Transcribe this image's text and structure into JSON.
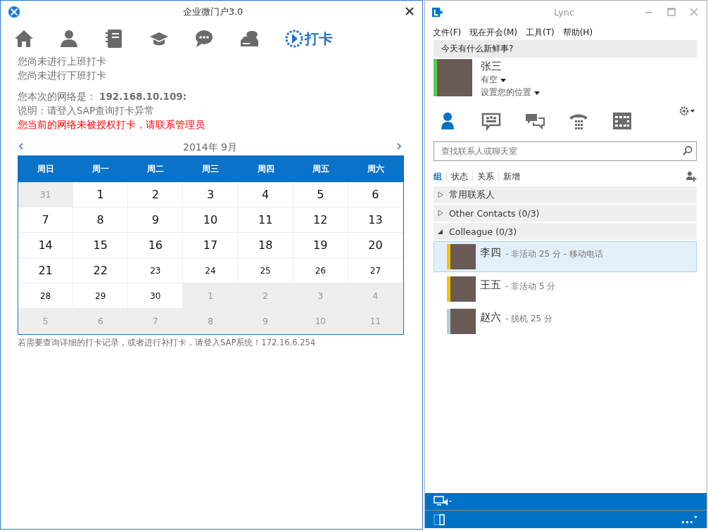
{
  "portal": {
    "title": "企业微门户3.0",
    "nav": [
      {
        "selected": false
      },
      {
        "selected": false
      },
      {
        "selected": false
      },
      {
        "selected": false
      },
      {
        "selected": false
      },
      {
        "selected": false
      },
      {
        "label": "打卡",
        "selected": true
      }
    ],
    "status_lines": [
      "您尚未进行上班打卡",
      "您尚未进行下班打卡"
    ],
    "network_label": "您本次的网络是：",
    "network_ip": "192.168.10.109:",
    "note": "说明：请登入SAP查询打卡异常",
    "warning": "您当前的网络未被授权打卡，请联系管理员",
    "calendar": {
      "month": "2014年 9月",
      "weekdays": [
        "周日",
        "周一",
        "周二",
        "周三",
        "周四",
        "周五",
        "周六"
      ],
      "weeks": [
        [
          {
            "day": "31",
            "in_month": false,
            "large": false
          },
          {
            "day": "1",
            "in_month": true,
            "large": true
          },
          {
            "day": "2",
            "in_month": true,
            "large": true
          },
          {
            "day": "3",
            "in_month": true,
            "large": true
          },
          {
            "day": "4",
            "in_month": true,
            "large": true
          },
          {
            "day": "5",
            "in_month": true,
            "large": true
          },
          {
            "day": "6",
            "in_month": true,
            "large": true
          }
        ],
        [
          {
            "day": "7",
            "in_month": true,
            "large": true
          },
          {
            "day": "8",
            "in_month": true,
            "large": true
          },
          {
            "day": "9",
            "in_month": true,
            "large": true
          },
          {
            "day": "10",
            "in_month": true,
            "large": true
          },
          {
            "day": "11",
            "in_month": true,
            "large": true
          },
          {
            "day": "12",
            "in_month": true,
            "large": true
          },
          {
            "day": "13",
            "in_month": true,
            "large": true
          }
        ],
        [
          {
            "day": "14",
            "in_month": true,
            "large": true
          },
          {
            "day": "15",
            "in_month": true,
            "large": true
          },
          {
            "day": "16",
            "in_month": true,
            "large": true
          },
          {
            "day": "17",
            "in_month": true,
            "large": true
          },
          {
            "day": "18",
            "in_month": true,
            "large": true
          },
          {
            "day": "19",
            "in_month": true,
            "large": true
          },
          {
            "day": "20",
            "in_month": true,
            "large": true
          }
        ],
        [
          {
            "day": "21",
            "in_month": true,
            "large": true
          },
          {
            "day": "22",
            "in_month": true,
            "large": true
          },
          {
            "day": "23",
            "in_month": true,
            "large": false
          },
          {
            "day": "24",
            "in_month": true,
            "large": false
          },
          {
            "day": "25",
            "in_month": true,
            "large": false
          },
          {
            "day": "26",
            "in_month": true,
            "large": false
          },
          {
            "day": "27",
            "in_month": true,
            "large": false
          }
        ],
        [
          {
            "day": "28",
            "in_month": true,
            "large": false
          },
          {
            "day": "29",
            "in_month": true,
            "large": false
          },
          {
            "day": "30",
            "in_month": true,
            "large": false
          },
          {
            "day": "1",
            "in_month": false,
            "large": false
          },
          {
            "day": "2",
            "in_month": false,
            "large": false
          },
          {
            "day": "3",
            "in_month": false,
            "large": false
          },
          {
            "day": "4",
            "in_month": false,
            "large": false
          }
        ],
        [
          {
            "day": "5",
            "in_month": false,
            "large": false
          },
          {
            "day": "6",
            "in_month": false,
            "large": false
          },
          {
            "day": "7",
            "in_month": false,
            "large": false
          },
          {
            "day": "8",
            "in_month": false,
            "large": false
          },
          {
            "day": "9",
            "in_month": false,
            "large": false
          },
          {
            "day": "10",
            "in_month": false,
            "large": false
          },
          {
            "day": "11",
            "in_month": false,
            "large": false
          }
        ]
      ]
    },
    "footer": "若需要查询详细的打卡记录，或者进行补打卡，请登入SAP系统！172.16.6.254"
  },
  "lync": {
    "title": "Lync",
    "menu": [
      "文件(F)",
      "现在开会(M)",
      "工具(T)",
      "帮助(H)"
    ],
    "whats_new": "今天有什么新鲜事?",
    "me": {
      "name": "张三",
      "status": "有空",
      "location": "设置您的位置",
      "color": "#5cc94a"
    },
    "tabs": [
      {
        "selected": true
      },
      {
        "selected": false
      },
      {
        "selected": false
      },
      {
        "selected": false
      },
      {
        "selected": false
      }
    ],
    "search": {
      "placeholder": "查找联系人或聊天室"
    },
    "filters": [
      {
        "label": "组",
        "selected": true
      },
      {
        "label": "状态",
        "selected": false
      },
      {
        "label": "关系",
        "selected": false
      },
      {
        "label": "新增",
        "selected": false
      }
    ],
    "groups": [
      {
        "name": "常用联系人",
        "expanded": false
      },
      {
        "name": "Other Contacts (0/3)",
        "expanded": false
      },
      {
        "name": "Colleague (0/3)",
        "expanded": true,
        "contacts": [
          {
            "name": "李四",
            "status": "- 非活动 25 分 - 移动电话",
            "color": "#f5c400",
            "selected": true
          },
          {
            "name": "王五",
            "status": "- 非活动 5 分",
            "color": "#f5c400",
            "selected": false
          },
          {
            "name": "赵六",
            "status": "- 脱机 25 分",
            "color": "#b3cdd8",
            "selected": false
          }
        ]
      }
    ]
  }
}
